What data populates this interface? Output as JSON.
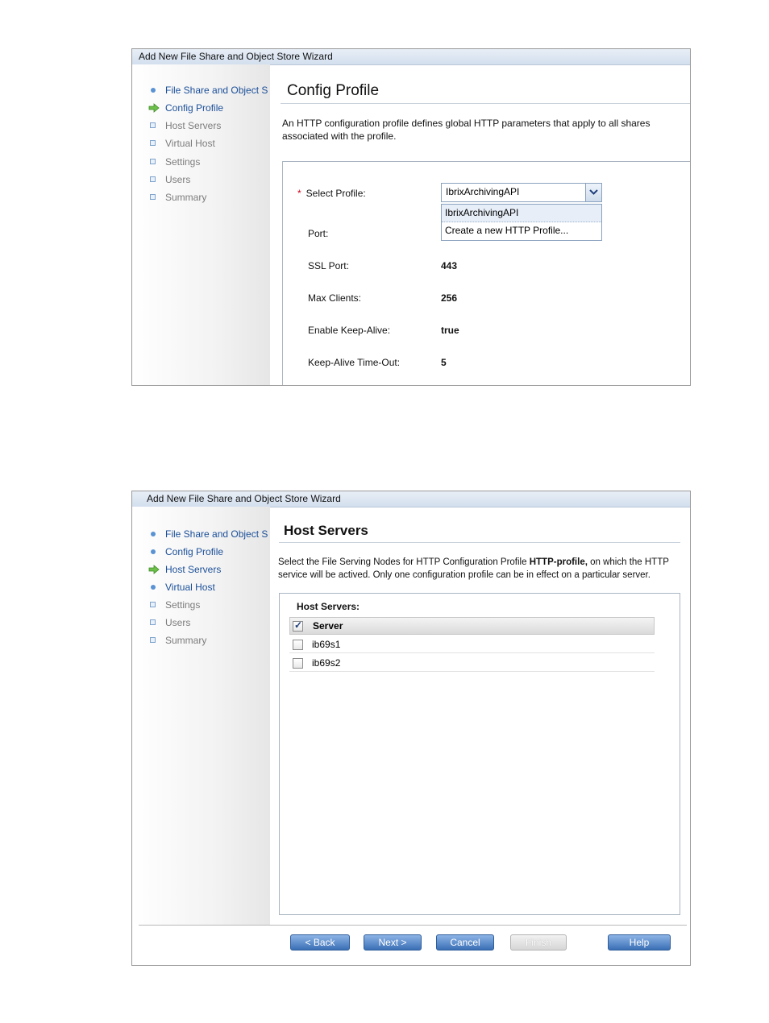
{
  "wizard1": {
    "title": "Add New File Share and Object Store Wizard",
    "steps": [
      {
        "label": "File Share and Object S",
        "state": "done"
      },
      {
        "label": "Config Profile",
        "state": "current"
      },
      {
        "label": "Host Servers",
        "state": "pending"
      },
      {
        "label": "Virtual Host",
        "state": "pending"
      },
      {
        "label": "Settings",
        "state": "pending"
      },
      {
        "label": "Users",
        "state": "pending"
      },
      {
        "label": "Summary",
        "state": "pending"
      }
    ],
    "heading": "Config Profile",
    "description": "An HTTP configuration profile defines global HTTP parameters that apply to all shares associated with the profile.",
    "required_marker": "*",
    "select_profile_label": "Select Profile:",
    "select_profile_value": "IbrixArchivingAPI",
    "dropdown_options": [
      "IbrixArchivingAPI",
      "Create a new HTTP Profile..."
    ],
    "fields": [
      {
        "label": "Port:",
        "value": ""
      },
      {
        "label": "SSL Port:",
        "value": "443"
      },
      {
        "label": "Max Clients:",
        "value": "256"
      },
      {
        "label": "Enable Keep-Alive:",
        "value": "true"
      },
      {
        "label": "Keep-Alive Time-Out:",
        "value": "5"
      }
    ]
  },
  "wizard2": {
    "title": "Add New File Share and Object Store Wizard",
    "steps": [
      {
        "label": "File Share and Object S",
        "state": "done"
      },
      {
        "label": "Config Profile",
        "state": "done"
      },
      {
        "label": "Host Servers",
        "state": "current"
      },
      {
        "label": "Virtual Host",
        "state": "done"
      },
      {
        "label": "Settings",
        "state": "pending"
      },
      {
        "label": "Users",
        "state": "pending"
      },
      {
        "label": "Summary",
        "state": "pending"
      }
    ],
    "heading": "Host Servers",
    "description_part1": "Select the File Serving Nodes for HTTP Configuration Profile ",
    "description_bold": "HTTP-profile,",
    "description_part2": " on which the HTTP service will be actived. Only one configuration profile can be in effect on a particular server.",
    "panel_label": "Host Servers:",
    "column_header": "Server",
    "header_checked": true,
    "rows": [
      {
        "name": "ib69s1",
        "checked": false
      },
      {
        "name": "ib69s2",
        "checked": false
      }
    ],
    "buttons": {
      "back": "< Back",
      "next": "Next >",
      "cancel": "Cancel",
      "finish": "Finish",
      "help": "Help"
    }
  }
}
